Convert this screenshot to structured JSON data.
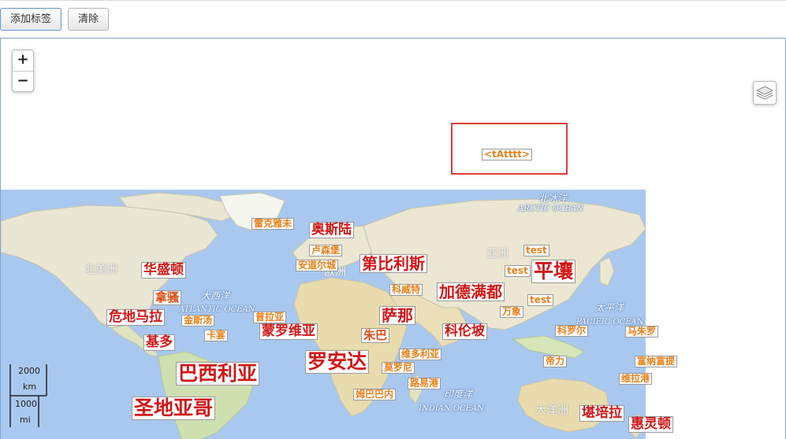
{
  "toolbar": {
    "add_tag_label": "添加标签",
    "clear_label": "清除"
  },
  "map": {
    "zoom_in": "+",
    "zoom_out": "−",
    "highlight_tag": "<tAtttt>",
    "scale": {
      "km_value": "2000",
      "km_unit": "km",
      "mi_value": "1000",
      "mi_unit": "mi"
    },
    "regions": {
      "arctic_cn": "北冰洋",
      "arctic_en": "ARCTIC OCEAN",
      "north_america": "北美洲",
      "asia": "亚洲",
      "europe": "欧洲",
      "atlantic_cn": "大西洋",
      "atlantic_en": "ATLANTIC OCEAN",
      "pacific_cn": "太平洋",
      "pacific_en": "PACIFIC OCEAN",
      "indian_cn": "印度洋",
      "indian_en": "INDIAN OCEAN",
      "oceania": "大洋洲"
    },
    "tags": {
      "reykjavik": "雷克雅未",
      "oslo": "奥斯陆",
      "luxembourg": "卢森堡",
      "andorra": "安道尔城",
      "tbilisi": "第比利斯",
      "test1": "test",
      "test2": "test",
      "test3": "test",
      "pyongyang": "平壤",
      "washington": "华盛顿",
      "nassau": "拿骚",
      "kuwait": "科威特",
      "kathmandu": "加德满都",
      "manila": "万象",
      "guatemala": "危地马拉",
      "kingston": "金斯汤",
      "praia": "普拉亚",
      "sanaa": "萨那",
      "monrovia": "蒙罗维亚",
      "colombo": "科伦坡",
      "koror": "科罗尔",
      "majuro": "马朱罗",
      "quito": "基多",
      "cayenne": "卡宴",
      "juba": "朱巴",
      "victoria": "维多利亚",
      "luanda": "罗安达",
      "brasilia": "巴西利亚",
      "moroni": "莫罗尼",
      "dili": "帝力",
      "funafuti": "富纳富提",
      "lusaka": "路易港",
      "portvila": "维拉港",
      "mbabane": "姆巴巴内",
      "santiago": "圣地亚哥",
      "canberra": "堪培拉",
      "wellington": "惠灵顿"
    }
  }
}
